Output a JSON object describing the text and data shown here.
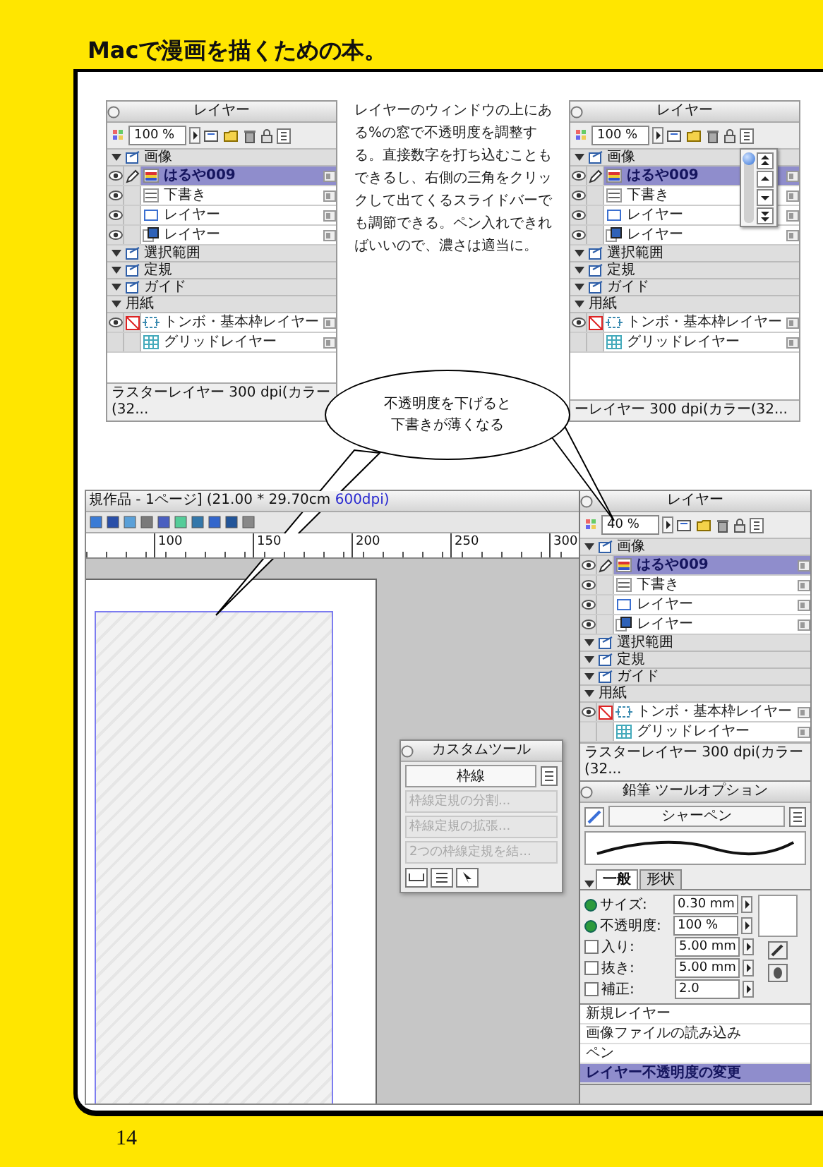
{
  "header": {
    "title": "Macで漫画を描くための本。"
  },
  "layer_panels": [
    {
      "title": "レイヤー",
      "opacity": "100 %",
      "status": "ラスターレイヤー 300 dpi(カラー(32...",
      "layers": [
        {
          "kind": "group",
          "label": "画像"
        },
        {
          "kind": "layer",
          "name": "はるや009",
          "thumbnail": {
            "kind": "color"
          },
          "selected": true,
          "visible": true,
          "protected": false
        },
        {
          "kind": "layer",
          "name": "下書き",
          "thumbnail": {
            "kind": "lines"
          },
          "selected": false,
          "visible": true,
          "protected": false
        },
        {
          "kind": "layer",
          "name": "レイヤー",
          "thumbnail": {
            "kind": "frame"
          },
          "selected": false,
          "visible": true,
          "protected": false
        },
        {
          "kind": "layer",
          "name": "レイヤー",
          "thumbnail": {
            "kind": "tone"
          },
          "selected": false,
          "visible": true,
          "protected": false
        },
        {
          "kind": "group",
          "label": "選択範囲"
        },
        {
          "kind": "group",
          "label": "定規"
        },
        {
          "kind": "group",
          "label": "ガイド"
        },
        {
          "kind": "paper",
          "label": "用紙"
        },
        {
          "kind": "layer",
          "name": "トンボ・基本枠レイヤー",
          "thumbnail": {
            "kind": "crop"
          },
          "selected": false,
          "visible": true,
          "protected": true
        },
        {
          "kind": "layer",
          "name": "グリッドレイヤー",
          "thumbnail": {
            "kind": "grid"
          },
          "selected": false,
          "visible": false,
          "protected": false
        }
      ]
    },
    {
      "title": "レイヤー",
      "opacity": "100 %",
      "status": "ーレイヤー 300 dpi(カラー(32...",
      "slider": {
        "level": 1
      },
      "layers": [
        {
          "kind": "group",
          "label": "画像"
        },
        {
          "kind": "layer",
          "name": "はるや009",
          "thumbnail": {
            "kind": "color"
          },
          "selected": true,
          "visible": true,
          "protected": false
        },
        {
          "kind": "layer",
          "name": "下書き",
          "thumbnail": {
            "kind": "lines"
          },
          "selected": false,
          "visible": true,
          "protected": false
        },
        {
          "kind": "layer",
          "name": "レイヤー",
          "thumbnail": {
            "kind": "frame"
          },
          "selected": false,
          "visible": true,
          "protected": false
        },
        {
          "kind": "layer",
          "name": "レイヤー",
          "thumbnail": {
            "kind": "tone"
          },
          "selected": false,
          "visible": true,
          "protected": false
        },
        {
          "kind": "group",
          "label": "選択範囲"
        },
        {
          "kind": "group",
          "label": "定規"
        },
        {
          "kind": "group",
          "label": "ガイド"
        },
        {
          "kind": "paper",
          "label": "用紙"
        },
        {
          "kind": "layer",
          "name": "トンボ・基本枠レイヤー",
          "thumbnail": {
            "kind": "crop"
          },
          "selected": false,
          "visible": true,
          "protected": true
        },
        {
          "kind": "layer",
          "name": "グリッドレイヤー",
          "thumbnail": {
            "kind": "grid"
          },
          "selected": false,
          "visible": false,
          "protected": false
        }
      ]
    }
  ],
  "explanation": "レイヤーのウィンドウの上にある%の窓で不透明度を調整する。直接数字を打ち込むこともできるし、右側の三角をクリックして出てくるスライドバーでも調節できる。ペン入れできればいいので、濃さは適当に。",
  "callout": {
    "lines": [
      "不透明度を下げると",
      "下書きが薄くなる"
    ]
  },
  "document_window": {
    "title": "規作品 - 1ページ] (21.00 * 29.70cm ",
    "title_dpi": "600dpi)",
    "ruler_labels": [
      "100",
      "150",
      "200",
      "250",
      "300"
    ],
    "custom_tool": {
      "title": "カスタムツール",
      "preset": "枠線",
      "commands": [
        {
          "label": "枠線定規の分割...",
          "disabled": true
        },
        {
          "label": "枠線定規の拡張...",
          "disabled": true
        },
        {
          "label": "2つの枠線定規を結...",
          "disabled": true
        }
      ]
    },
    "layer_panel": {
      "title": "レイヤー",
      "opacity": "40 %",
      "status": "ラスターレイヤー 300 dpi(カラー(32...",
      "layers": [
        {
          "kind": "group",
          "label": "画像"
        },
        {
          "kind": "layer",
          "name": "はるや009",
          "thumbnail": {
            "kind": "color"
          },
          "selected": true,
          "visible": true,
          "protected": false
        },
        {
          "kind": "layer",
          "name": "下書き",
          "thumbnail": {
            "kind": "lines"
          },
          "selected": false,
          "visible": true,
          "protected": false
        },
        {
          "kind": "layer",
          "name": "レイヤー",
          "thumbnail": {
            "kind": "frame"
          },
          "selected": false,
          "visible": true,
          "protected": false
        },
        {
          "kind": "layer",
          "name": "レイヤー",
          "thumbnail": {
            "kind": "tone"
          },
          "selected": false,
          "visible": true,
          "protected": false
        },
        {
          "kind": "group",
          "label": "選択範囲"
        },
        {
          "kind": "group",
          "label": "定規"
        },
        {
          "kind": "group",
          "label": "ガイド"
        },
        {
          "kind": "paper",
          "label": "用紙"
        },
        {
          "kind": "layer",
          "name": "トンボ・基本枠レイヤー",
          "thumbnail": {
            "kind": "crop"
          },
          "selected": false,
          "visible": true,
          "protected": true
        },
        {
          "kind": "layer",
          "name": "グリッドレイヤー",
          "thumbnail": {
            "kind": "grid"
          },
          "selected": false,
          "visible": false,
          "protected": false
        }
      ]
    },
    "tool_options": {
      "title": "鉛筆 ツールオプション",
      "tool": "シャーペン",
      "tabs": [
        {
          "label": "一般",
          "selected": true
        },
        {
          "label": "形状",
          "selected": false
        }
      ],
      "fields": [
        {
          "kind": "dot",
          "label": "サイズ:",
          "value": "0.30 mm"
        },
        {
          "kind": "dot",
          "label": "不透明度:",
          "value": "100 %"
        },
        {
          "kind": "checkbox",
          "label": "入り:",
          "value": "5.00 mm",
          "checked": false
        },
        {
          "kind": "checkbox",
          "label": "抜き:",
          "value": "5.00 mm",
          "checked": false
        },
        {
          "kind": "checkbox",
          "label": "補正:",
          "value": "2.0",
          "checked": false
        }
      ]
    },
    "history": [
      {
        "label": "新規レイヤー",
        "selected": false
      },
      {
        "label": "画像ファイルの読み込み",
        "selected": false
      },
      {
        "label": "ペン",
        "selected": false
      },
      {
        "label": "レイヤー不透明度の変更",
        "selected": true
      }
    ]
  },
  "page_number": "14"
}
